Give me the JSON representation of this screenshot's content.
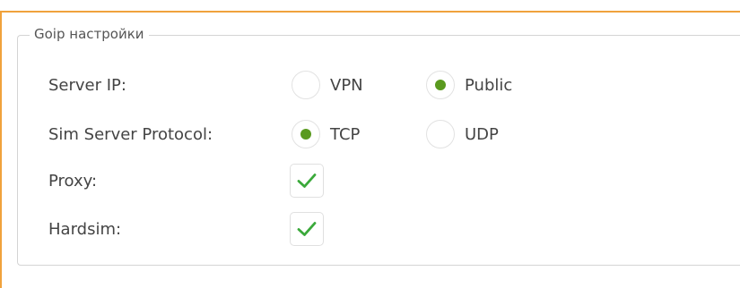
{
  "section": {
    "title": "Goip настройки"
  },
  "rows": [
    {
      "label": "Server IP:",
      "options": [
        {
          "label": "VPN",
          "selected": false
        },
        {
          "label": "Public",
          "selected": true
        }
      ]
    },
    {
      "label": "Sim Server Protocol:",
      "options": [
        {
          "label": "TCP",
          "selected": true
        },
        {
          "label": "UDP",
          "selected": false
        }
      ]
    },
    {
      "label": "Proxy:",
      "checked": true
    },
    {
      "label": "Hardsim:",
      "checked": true
    }
  ],
  "colors": {
    "accent": "#f0a23c",
    "radio_selected": "#5a9a1f",
    "checkmark": "#3aa93a"
  },
  "icons": {
    "check": "checkmark-icon"
  }
}
